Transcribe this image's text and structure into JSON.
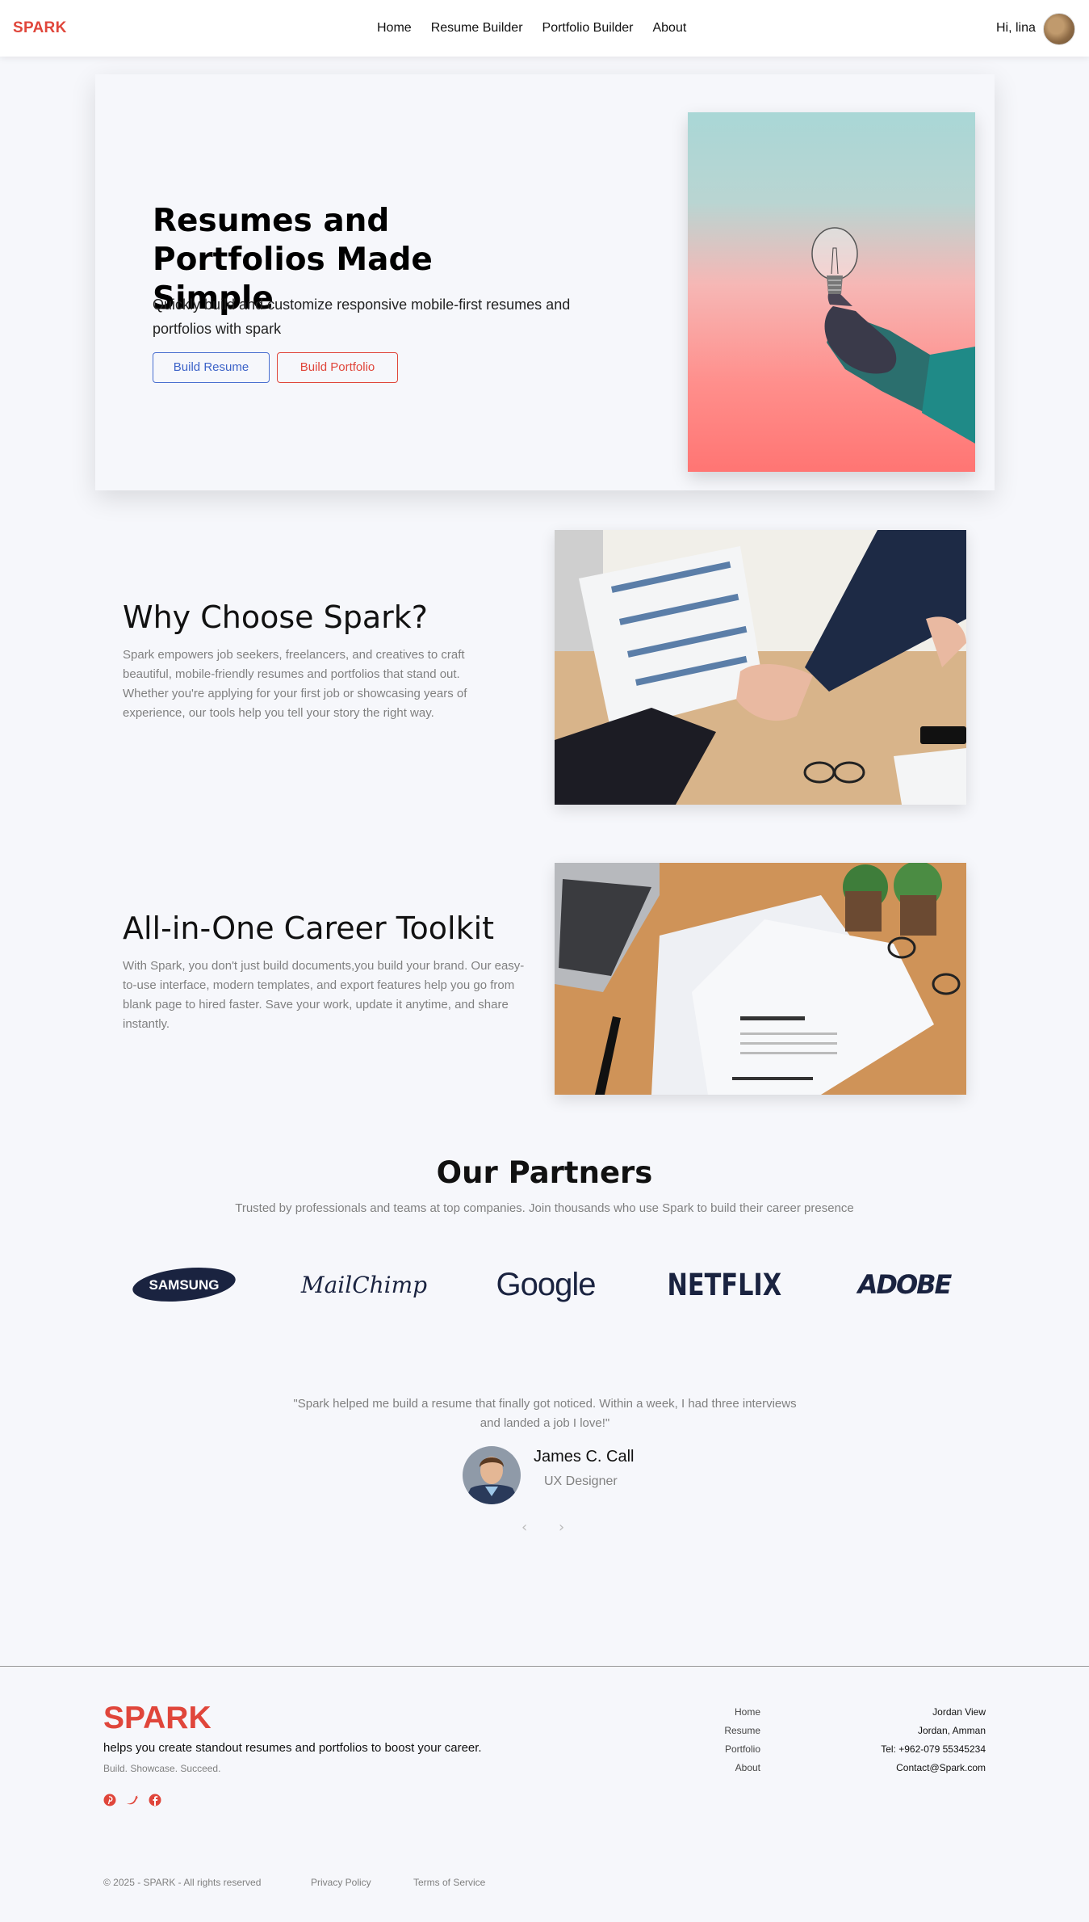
{
  "navbar": {
    "brand": "SPARK",
    "links": [
      "Home",
      "Resume Builder",
      "Portfolio Builder",
      "About"
    ],
    "greeting": "Hi, lina"
  },
  "hero": {
    "title": "Resumes and Portfolios Made Simple",
    "subtitle": "Quickly build and customize responsive mobile-first resumes and portfolios with spark",
    "build_resume_label": "Build Resume",
    "build_portfolio_label": "Build Portfolio"
  },
  "why": {
    "title": "Why Choose Spark?",
    "text": "Spark empowers job seekers, freelancers, and creatives to craft beautiful, mobile-friendly resumes and portfolios that stand out. Whether you're applying for your first job or showcasing years of experience, our tools help you tell your story the right way."
  },
  "toolkit": {
    "title": "All-in-One Career Toolkit",
    "text": "With Spark, you don't just build documents,you build your brand. Our easy-to-use interface, modern templates, and export features help you go from blank page to hired faster. Save your work, update it anytime, and share instantly."
  },
  "partners": {
    "title": "Our Partners",
    "subtitle": "Trusted by professionals and teams at top companies. Join thousands who use Spark to build their career presence",
    "logos": [
      "SAMSUNG",
      "MailChimp",
      "Google",
      "NETFLIX",
      "ADOBE"
    ]
  },
  "testimonial": {
    "quote": "\"Spark helped me build a resume that finally got noticed. Within a week, I had three interviews and landed a job I love!\"",
    "name": "James C. Call",
    "role": "UX Designer",
    "prev": "‹",
    "next": "›"
  },
  "footer": {
    "brand": "SPARK",
    "tagline": "helps you create standout resumes and portfolios to boost your career.",
    "motto": "Build. Showcase. Succeed.",
    "links": [
      "Home",
      "Resume",
      "Portfolio",
      "About"
    ],
    "contact": [
      "Jordan View",
      "Jordan, Amman",
      "Tel: +962-079 55345234",
      "Contact@Spark.com"
    ],
    "copyright": "© 2025 - SPARK - All rights reserved",
    "privacy": "Privacy Policy",
    "terms": "Terms of Service",
    "social_icons": [
      "pinterest-icon",
      "twitter-icon",
      "facebook-icon"
    ]
  },
  "colors": {
    "brand_red": "#e0463b",
    "button_blue": "#3d63c8",
    "page_bg": "#f6f7fb"
  }
}
